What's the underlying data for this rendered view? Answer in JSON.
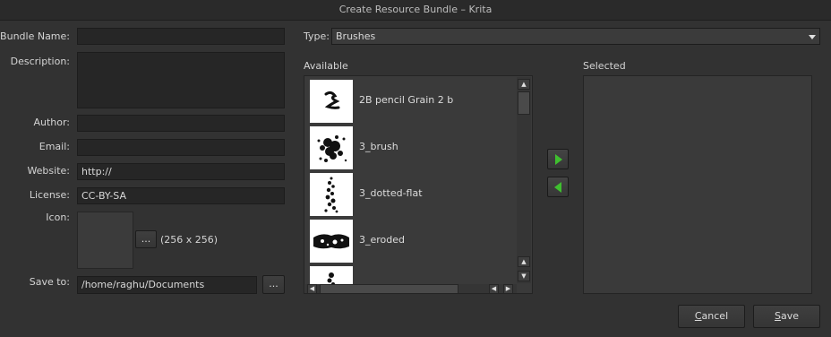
{
  "window": {
    "title": "Create Resource Bundle – Krita"
  },
  "form": {
    "bundle_name": {
      "label": "Bundle Name:",
      "value": ""
    },
    "description": {
      "label": "Description:",
      "value": ""
    },
    "author": {
      "label": "Author:",
      "value": ""
    },
    "email": {
      "label": "Email:",
      "value": ""
    },
    "website": {
      "label": "Website:",
      "value": "http://"
    },
    "license": {
      "label": "License:",
      "value": "CC-BY-SA"
    },
    "icon": {
      "label": "Icon:",
      "browse_label": "...",
      "size_text": "(256 x 256)"
    },
    "save_to": {
      "label": "Save to:",
      "value": "/home/raghu/Documents",
      "browse_label": "..."
    }
  },
  "type": {
    "label": "Type:",
    "selected": "Brushes"
  },
  "available": {
    "header": "Available",
    "items": [
      {
        "name": "2B pencil Grain 2 b"
      },
      {
        "name": "3_brush"
      },
      {
        "name": "3_dotted-flat"
      },
      {
        "name": "3_eroded"
      },
      {
        "name": ""
      }
    ]
  },
  "selected": {
    "header": "Selected"
  },
  "buttons": {
    "cancel": {
      "mnemonic": "C",
      "rest": "ancel"
    },
    "save": {
      "mnemonic": "S",
      "rest": "ave"
    }
  },
  "colors": {
    "arrow": "#3fbf2f",
    "background": "#323232",
    "field": "#262626"
  }
}
